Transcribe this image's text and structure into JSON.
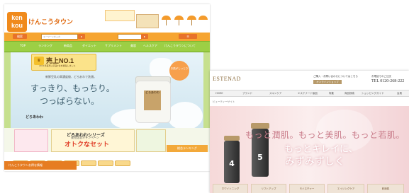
{
  "left_site": {
    "logo_top": "ken",
    "logo_bottom": "kou",
    "site_name": "けんこうタウン",
    "search_placeholder": "キーワードを入力",
    "search_button": "検索",
    "nav_items": [
      "TOP",
      "ランキング",
      "新商品",
      "ダイエット",
      "サプリメント",
      "美容",
      "ヘルスケア",
      "けんこうタウンについて"
    ],
    "award_title": "売上NO.1",
    "award_sub": "2011年度売上高第1位を獲得しました",
    "hero_small": "新鮮豆乳の高濃度級、どろあわで洗顔。",
    "hero_line1": "すっきり、もっちり。",
    "hero_line2": "つっぱらない。",
    "product_label": "どろあわわ",
    "badge_text": "お肌がしっとり",
    "promo_title": "どろあわわシリーズ",
    "promo_sub": "発売記念キャンペーン",
    "promo_deal": "オトクなセット",
    "ranking_label": "総合ランキング",
    "bottom_bar": "けんこうタウンお得な情報"
  },
  "right_site": {
    "logo": "ESTENAD",
    "info_text": "ご購入・お問い合わせについてはこちら",
    "tel_label": "お電話でのご注文",
    "tel": "TEL 0120-268-222",
    "button": "オンラインショップ",
    "nav_items": [
      "HOME",
      "ブランド",
      "スキンケア",
      "エステナード製品",
      "特集",
      "商品検索",
      "ショッピングガイド",
      "会員"
    ],
    "breadcrumb": "ビューティーサイト",
    "hero_line1": "もっと潤肌。もっと美肌。もっと若肌。",
    "hero_line2": "もっとキレイに、",
    "hero_line3": "みずみずしく",
    "tube_numbers": [
      "5",
      "4"
    ],
    "strip_labels": [
      "ホワイトニング",
      "リフトアップ",
      "モイスチャー",
      "エイジングケア",
      "乾燥肌"
    ]
  }
}
